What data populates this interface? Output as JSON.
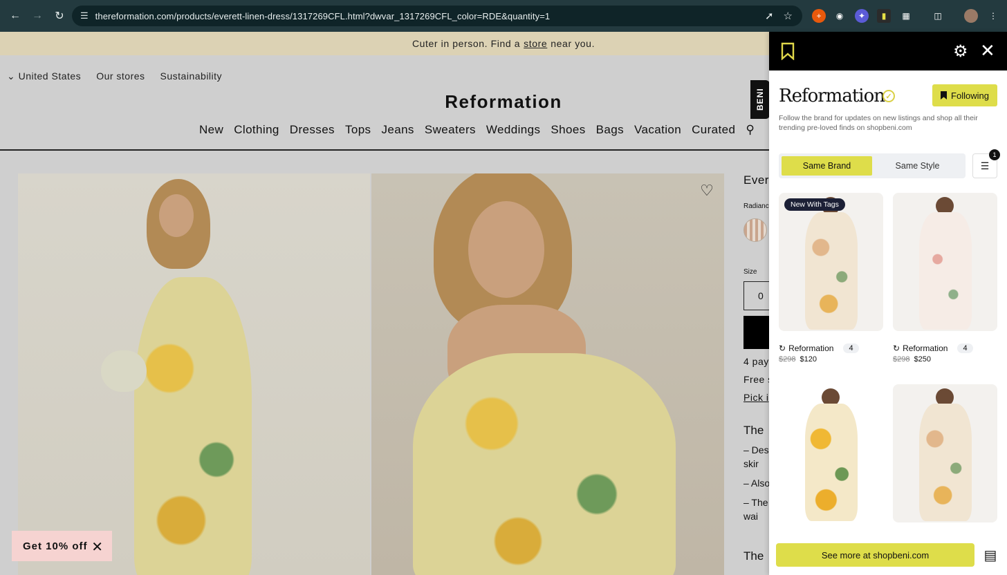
{
  "browser": {
    "url": "thereformation.com/products/everett-linen-dress/1317269CFL.html?dwvar_1317269CFL_color=RDE&quantity=1"
  },
  "promo": {
    "before": "Cuter in person. Find a",
    "link": "store",
    "after": "near you."
  },
  "utility": {
    "country": "United States",
    "stores": "Our stores",
    "sustainability": "Sustainability"
  },
  "site": {
    "logo": "Reformation"
  },
  "nav": [
    "New",
    "Clothing",
    "Dresses",
    "Tops",
    "Jeans",
    "Sweaters",
    "Weddings",
    "Shoes",
    "Bags",
    "Vacation",
    "Curated"
  ],
  "product": {
    "title": "Ever",
    "color_label": "Radianc",
    "size_label": "Size",
    "size_first": "0",
    "payments": "4 pay",
    "shipping": "Free s",
    "pickup": "Pick i",
    "details_heading": "The",
    "bullets": [
      "– Des\nskir",
      "– Also",
      "– The\nwai"
    ],
    "second_heading": "The"
  },
  "discount": {
    "label": "Get 10% off"
  },
  "beni": {
    "tab_label": "BENI",
    "brand": "Reformation",
    "follow_label": "Following",
    "description": "Follow the brand for updates on new listings and shop all their trending pre-loved finds on shopbeni.com",
    "tabs": [
      "Same Brand",
      "Same Style"
    ],
    "filter_count": "1",
    "cards": [
      {
        "tag": "New With Tags",
        "brand": "Reformation",
        "count": "4",
        "old_price": "$298",
        "price": "$120"
      },
      {
        "tag": "",
        "brand": "Reformation",
        "count": "4",
        "old_price": "$298",
        "price": "$250"
      },
      {
        "tag": "",
        "brand": "",
        "count": "",
        "old_price": "",
        "price": ""
      },
      {
        "tag": "",
        "brand": "",
        "count": "",
        "old_price": "",
        "price": ""
      }
    ],
    "see_more": "See more at shopbeni.com"
  },
  "colors": {
    "accent": "#dedd4a",
    "chrome": "#233a3f",
    "promo": "#dcd2b4"
  }
}
